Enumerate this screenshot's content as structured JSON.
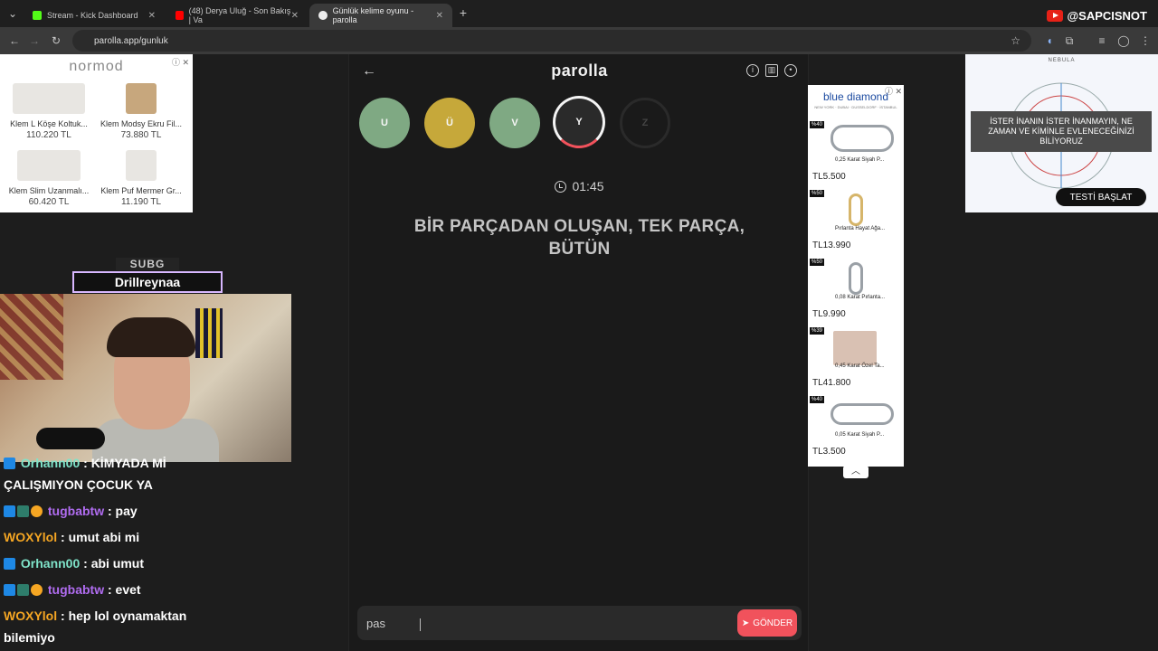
{
  "browser": {
    "tabs": [
      {
        "title": "Stream - Kick Dashboard",
        "favicon_color": "#53fc18"
      },
      {
        "title": "(48) Derya Uluğ - Son Bakış | Va",
        "favicon_color": "#ff0000"
      },
      {
        "title": "Günlük kelime oyunu - parolla",
        "favicon_color": "#eeeeee"
      }
    ],
    "url": "parolla.app/gunluk"
  },
  "overlay": {
    "yt_handle": "@SAPCISNOT",
    "sub_label": "SUBG",
    "sub_name": "Drillreynaa"
  },
  "ad_left": {
    "brand": "normod",
    "products": [
      {
        "name": "Klem L Köşe Koltuk...",
        "price": "110.220 TL"
      },
      {
        "name": "Klem Modsy Ekru Fil...",
        "price": "73.880 TL"
      },
      {
        "name": "Klem Slim Uzanmalı...",
        "price": "60.420 TL"
      },
      {
        "name": "Klem Puf Mermer Gr...",
        "price": "11.190 TL"
      }
    ]
  },
  "ad_right": {
    "brand": "NEBULA",
    "headline": "İSTER İNANIN İSTER İNANMAYIN, NE ZAMAN VE KİMİNLE EVLENECEĞİNİZİ BİLİYORUZ",
    "cta": "TESTİ BAŞLAT"
  },
  "chat": [
    {
      "user": "Orhann00",
      "text": ": KİMYADA Mİ",
      "color": "#7fe3c9"
    },
    {
      "user": "",
      "text": "ÇALIŞMIYON ÇOCUK YA",
      "color": "#ffffff"
    },
    {
      "user": "tugbabtw",
      "text": ": pay",
      "color": "#b06cf0"
    },
    {
      "user": "WOXYlol",
      "text": ": umut abi mi",
      "color": "#f5a623"
    },
    {
      "user": "Orhann00",
      "text": ": abi umut",
      "color": "#7fe3c9"
    },
    {
      "user": "tugbabtw",
      "text": ": evet",
      "color": "#b06cf0"
    },
    {
      "user": "WOXYlol",
      "text": ": hep lol oynamaktan",
      "color": "#f5a623"
    },
    {
      "user": "",
      "text": "bilemiyo",
      "color": "#ffffff"
    }
  ],
  "game": {
    "logo": "parolla",
    "letters": [
      {
        "letter": "U",
        "state": "correct",
        "color": "#7fa983"
      },
      {
        "letter": "Ü",
        "state": "passed",
        "color": "#c6a83a"
      },
      {
        "letter": "V",
        "state": "correct",
        "color": "#7fa983"
      },
      {
        "letter": "Y",
        "state": "current",
        "color": "#2a2a2a"
      },
      {
        "letter": "Z",
        "state": "pending",
        "color": "#1f1f1f"
      }
    ],
    "timer": "01:45",
    "question_line1": "BİR PARÇADAN OLUŞAN, TEK PARÇA,",
    "question_line2": "BÜTÜN",
    "input_value": "pas",
    "send_label": "GÖNDER"
  },
  "jewelry_ad": {
    "brand": "blue diamond",
    "cities": "NEW YORK · DUBAI · DUSSELDORF · İSTANBUL",
    "items": [
      {
        "discount": "%40",
        "name": "0,25 Karat Siyah P...",
        "price": "TL5.500"
      },
      {
        "discount": "%50",
        "name": "Pırlanta Hayat Ağa...",
        "price": "TL13.990"
      },
      {
        "discount": "%50",
        "name": "0,08 Karat Pırlanta...",
        "price": "TL9.990"
      },
      {
        "discount": "%39",
        "name": "0,45 Karat Özel Ta...",
        "price": "TL41.800"
      },
      {
        "discount": "%40",
        "name": "0,05 Karat Siyah P...",
        "price": "TL3.500"
      }
    ]
  }
}
